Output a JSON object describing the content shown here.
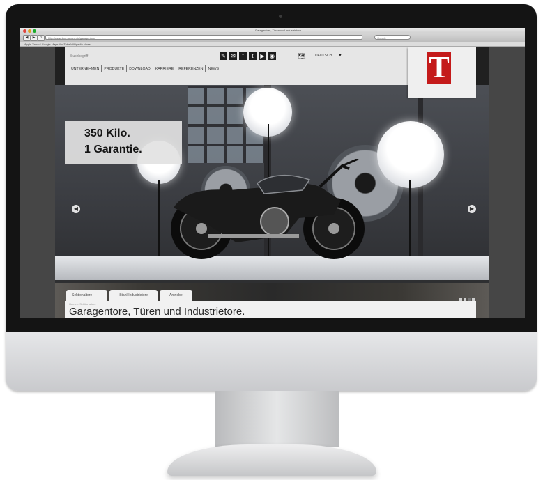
{
  "browser": {
    "window_title": "Garagentore, Türen und Industrietore",
    "url": "http://www.tore-tueren.de/garagentore",
    "search_placeholder": "Google",
    "bookmarks": "Apple  Yahoo!  Google Maps  YouTube  Wikipedia  News"
  },
  "header": {
    "search_label": "Suchbegriff",
    "language": "DEUTSCH",
    "social_icons": [
      "pen-icon",
      "mail-icon",
      "facebook-icon",
      "twitter-icon",
      "youtube-icon",
      "rss-icon"
    ],
    "world_icon": "world-map-icon",
    "logo_letter": "T",
    "logo_color": "#c41a1a"
  },
  "nav": {
    "items": [
      "Unternehmen",
      "Produkte",
      "Download",
      "Karriere",
      "Referenzen",
      "News"
    ]
  },
  "hero": {
    "headline_line1": "350 Kilo.",
    "headline_line2": "1 Garantie.",
    "prev_label": "◀",
    "next_label": "▶"
  },
  "tabs": [
    "Sektionaltore",
    "Stahl-Industrietore",
    "Antriebe"
  ],
  "content": {
    "breadcrumb": "Home > Sektionaltore",
    "heading": "Garagentore, Türen und Industrietore."
  }
}
